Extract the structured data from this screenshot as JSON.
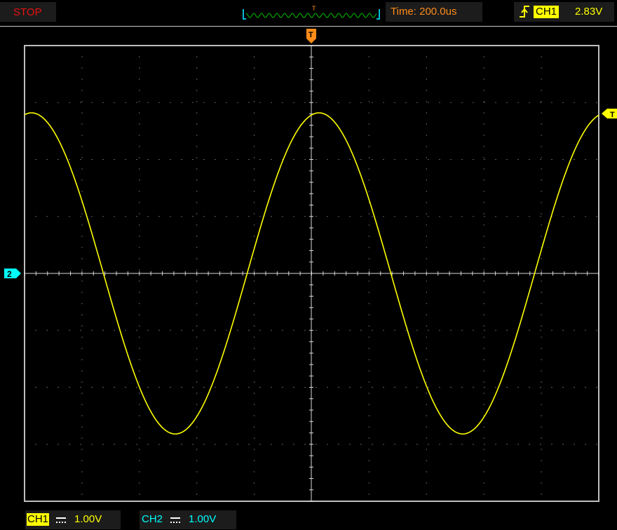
{
  "status": {
    "label": "STOP",
    "color": "#e81010"
  },
  "overview": {
    "trigger_marker": "T"
  },
  "timebase": {
    "label": "Time: 200.0us"
  },
  "trigger": {
    "slope_icon": "rising-edge-icon",
    "source": "CH1",
    "level": "2.83V",
    "top_marker": "T",
    "right_marker": "T"
  },
  "channel2_marker": "2",
  "channels": [
    {
      "label": "CH1",
      "coupling_icon": "dc-coupling-icon",
      "scale": "1.00V",
      "color": "#ffff00"
    },
    {
      "label": "CH2",
      "coupling_icon": "dc-coupling-icon",
      "scale": "1.00V",
      "color": "#00ffff"
    }
  ],
  "waveform": {
    "shape": "sine",
    "color": "#ffff00",
    "cycles_visible": 2,
    "phase_start": "peak"
  }
}
